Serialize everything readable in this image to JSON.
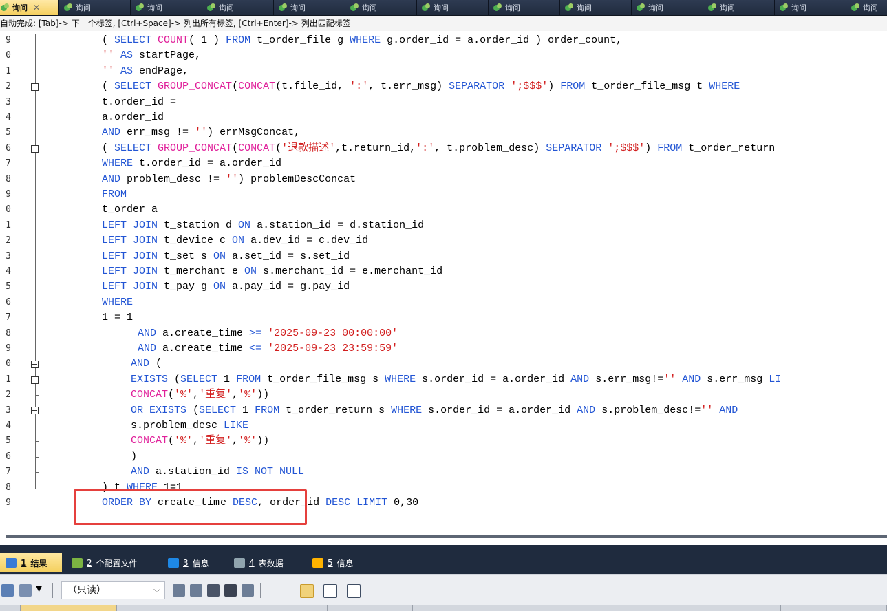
{
  "tabs": {
    "active_label": "询问",
    "close_glyph": "✕",
    "other_label": "询问",
    "other_count": 12
  },
  "hint": {
    "text": "自动完成: [Tab]-> 下一个标签, [Ctrl+Space]-> 列出所有标签, [Ctrl+Enter]-> 列出匹配标签"
  },
  "editor": {
    "line_numbers": [
      "9",
      "0",
      "1",
      "2",
      "3",
      "4",
      "5",
      "6",
      "7",
      "8",
      "9",
      "0",
      "1",
      "2",
      "3",
      "4",
      "5",
      "6",
      "7",
      "8",
      "9",
      "0",
      "1",
      "2",
      "3",
      "4",
      "5",
      "6",
      "7",
      "8",
      "9"
    ],
    "lines": [
      {
        "indent": "0",
        "tokens": [
          [
            "p",
            "( "
          ],
          [
            "kw",
            "SELECT "
          ],
          [
            "fn",
            "COUNT"
          ],
          [
            "p",
            "( 1 ) "
          ],
          [
            "kw",
            "FROM "
          ],
          [
            "p",
            "t_order_file g "
          ],
          [
            "kw",
            "WHERE "
          ],
          [
            "p",
            "g.order_id = a.order_id ) order_count,"
          ]
        ]
      },
      {
        "indent": "0",
        "tokens": [
          [
            "str",
            "'' "
          ],
          [
            "kw",
            "AS "
          ],
          [
            "p",
            "startPage,"
          ]
        ]
      },
      {
        "indent": "0",
        "tokens": [
          [
            "str",
            "'' "
          ],
          [
            "kw",
            "AS "
          ],
          [
            "p",
            "endPage,"
          ]
        ]
      },
      {
        "indent": "0",
        "tokens": [
          [
            "p",
            "( "
          ],
          [
            "kw",
            "SELECT "
          ],
          [
            "fn",
            "GROUP_CONCAT"
          ],
          [
            "p",
            "("
          ],
          [
            "fn",
            "CONCAT"
          ],
          [
            "p",
            "(t.file_id, "
          ],
          [
            "str",
            "':'"
          ],
          [
            "p",
            ", t.err_msg) "
          ],
          [
            "kw",
            "SEPARATOR "
          ],
          [
            "str",
            "';$$$'"
          ],
          [
            "p",
            ") "
          ],
          [
            "kw",
            "FROM "
          ],
          [
            "p",
            "t_order_file_msg t "
          ],
          [
            "kw",
            "WHERE"
          ]
        ]
      },
      {
        "indent": "0",
        "tokens": [
          [
            "p",
            "t.order_id ="
          ]
        ]
      },
      {
        "indent": "0",
        "tokens": [
          [
            "p",
            "a.order_id"
          ]
        ]
      },
      {
        "indent": "0",
        "tokens": [
          [
            "kw",
            "AND "
          ],
          [
            "p",
            "err_msg != "
          ],
          [
            "str",
            "''"
          ],
          [
            "p",
            ") errMsgConcat,"
          ]
        ]
      },
      {
        "indent": "0",
        "tokens": [
          [
            "p",
            "( "
          ],
          [
            "kw",
            "SELECT "
          ],
          [
            "fn",
            "GROUP_CONCAT"
          ],
          [
            "p",
            "("
          ],
          [
            "fn",
            "CONCAT"
          ],
          [
            "p",
            "("
          ],
          [
            "str",
            "'退款描述'"
          ],
          [
            "p",
            ",t.return_id,"
          ],
          [
            "str",
            "':'"
          ],
          [
            "p",
            ", t.problem_desc) "
          ],
          [
            "kw",
            "SEPARATOR "
          ],
          [
            "str",
            "';$$$'"
          ],
          [
            "p",
            ") "
          ],
          [
            "kw",
            "FROM "
          ],
          [
            "p",
            "t_order_return"
          ]
        ]
      },
      {
        "indent": "0",
        "tokens": [
          [
            "kw",
            "WHERE "
          ],
          [
            "p",
            "t.order_id = a.order_id"
          ]
        ]
      },
      {
        "indent": "0",
        "tokens": [
          [
            "kw",
            "AND "
          ],
          [
            "p",
            "problem_desc != "
          ],
          [
            "str",
            "''"
          ],
          [
            "p",
            ") problemDescConcat"
          ]
        ]
      },
      {
        "indent": "0",
        "tokens": [
          [
            "kw",
            "FROM"
          ]
        ]
      },
      {
        "indent": "0",
        "tokens": [
          [
            "p",
            "t_order a"
          ]
        ]
      },
      {
        "indent": "0",
        "tokens": [
          [
            "kw",
            "LEFT JOIN "
          ],
          [
            "p",
            "t_station d "
          ],
          [
            "kw",
            "ON "
          ],
          [
            "p",
            "a.station_id = d.station_id"
          ]
        ]
      },
      {
        "indent": "0",
        "tokens": [
          [
            "kw",
            "LEFT JOIN "
          ],
          [
            "p",
            "t_device c "
          ],
          [
            "kw",
            "ON "
          ],
          [
            "p",
            "a.dev_id = c.dev_id"
          ]
        ]
      },
      {
        "indent": "0",
        "tokens": [
          [
            "kw",
            "LEFT JOIN "
          ],
          [
            "p",
            "t_set s "
          ],
          [
            "kw",
            "ON "
          ],
          [
            "p",
            "a.set_id = s.set_id"
          ]
        ]
      },
      {
        "indent": "0",
        "tokens": [
          [
            "kw",
            "LEFT JOIN "
          ],
          [
            "p",
            "t_merchant e "
          ],
          [
            "kw",
            "ON "
          ],
          [
            "p",
            "s.merchant_id = e.merchant_id"
          ]
        ]
      },
      {
        "indent": "0",
        "tokens": [
          [
            "kw",
            "LEFT JOIN "
          ],
          [
            "p",
            "t_pay g "
          ],
          [
            "kw",
            "ON "
          ],
          [
            "p",
            "a.pay_id = g.pay_id"
          ]
        ]
      },
      {
        "indent": "0",
        "tokens": [
          [
            "kw",
            "WHERE"
          ]
        ]
      },
      {
        "indent": "0",
        "tokens": [
          [
            "p",
            "1 = 1"
          ]
        ]
      },
      {
        "indent": "2",
        "tokens": [
          [
            "kw",
            "AND "
          ],
          [
            "p",
            "a.create_time "
          ],
          [
            "kw",
            ">= "
          ],
          [
            "str",
            "'2025-09-23 00:00:00'"
          ]
        ]
      },
      {
        "indent": "2",
        "tokens": [
          [
            "kw",
            "AND "
          ],
          [
            "p",
            "a.create_time "
          ],
          [
            "kw",
            "<= "
          ],
          [
            "str",
            "'2025-09-23 23:59:59'"
          ]
        ]
      },
      {
        "indent": "1",
        "tokens": [
          [
            "kw",
            "AND "
          ],
          [
            "p",
            "("
          ]
        ]
      },
      {
        "indent": "1",
        "tokens": [
          [
            "kw",
            "EXISTS "
          ],
          [
            "p",
            "("
          ],
          [
            "kw",
            "SELECT "
          ],
          [
            "p",
            "1 "
          ],
          [
            "kw",
            "FROM "
          ],
          [
            "p",
            "t_order_file_msg s "
          ],
          [
            "kw",
            "WHERE "
          ],
          [
            "p",
            "s.order_id = a.order_id "
          ],
          [
            "kw",
            "AND "
          ],
          [
            "p",
            "s.err_msg!="
          ],
          [
            "str",
            "''"
          ],
          [
            "kw",
            " AND "
          ],
          [
            "p",
            "s.err_msg "
          ],
          [
            "kw",
            "LI"
          ]
        ]
      },
      {
        "indent": "1",
        "tokens": [
          [
            "fn",
            "CONCAT"
          ],
          [
            "p",
            "("
          ],
          [
            "str",
            "'%'"
          ],
          [
            "p",
            ","
          ],
          [
            "str",
            "'重复'"
          ],
          [
            "p",
            ","
          ],
          [
            "str",
            "'%'"
          ],
          [
            "p",
            "))"
          ]
        ]
      },
      {
        "indent": "1",
        "tokens": [
          [
            "kw",
            "OR EXISTS "
          ],
          [
            "p",
            "("
          ],
          [
            "kw",
            "SELECT "
          ],
          [
            "p",
            "1 "
          ],
          [
            "kw",
            "FROM "
          ],
          [
            "p",
            "t_order_return s "
          ],
          [
            "kw",
            "WHERE "
          ],
          [
            "p",
            "s.order_id = a.order_id "
          ],
          [
            "kw",
            "AND "
          ],
          [
            "p",
            "s.problem_desc!="
          ],
          [
            "str",
            "''"
          ],
          [
            "kw",
            " AND"
          ]
        ]
      },
      {
        "indent": "1",
        "tokens": [
          [
            "p",
            "s.problem_desc "
          ],
          [
            "kw",
            "LIKE"
          ]
        ]
      },
      {
        "indent": "1",
        "tokens": [
          [
            "fn",
            "CONCAT"
          ],
          [
            "p",
            "("
          ],
          [
            "str",
            "'%'"
          ],
          [
            "p",
            ","
          ],
          [
            "str",
            "'重复'"
          ],
          [
            "p",
            ","
          ],
          [
            "str",
            "'%'"
          ],
          [
            "p",
            "))"
          ]
        ]
      },
      {
        "indent": "1",
        "tokens": [
          [
            "p",
            ")"
          ]
        ]
      },
      {
        "indent": "1",
        "tokens": [
          [
            "kw",
            "AND "
          ],
          [
            "p",
            "a.station_id "
          ],
          [
            "kw",
            "IS NOT NULL"
          ]
        ]
      },
      {
        "indent": "0",
        "tokens": [
          [
            "p",
            ") t "
          ],
          [
            "kw",
            "WHERE "
          ],
          [
            "p",
            "1=1"
          ]
        ]
      },
      {
        "indent": "0",
        "tokens": [
          [
            "kw",
            "ORDER BY "
          ],
          [
            "p",
            "create_tim"
          ],
          [
            "cursor",
            ""
          ],
          [
            "p",
            "e "
          ],
          [
            "kw",
            "DESC"
          ],
          [
            "p",
            ", order_id "
          ],
          [
            "kw",
            "DESC LIMIT "
          ],
          [
            "p",
            "0,30"
          ]
        ]
      }
    ]
  },
  "results": {
    "tabs": [
      {
        "num": "1",
        "label": "结果",
        "icon": "grid-icon",
        "active": true
      },
      {
        "num": "2",
        "label": "个配置文件",
        "icon": "profile-icon",
        "active": false
      },
      {
        "num": "3",
        "label": "信息",
        "icon": "info-icon",
        "active": false
      },
      {
        "num": "4",
        "label": "表数据",
        "icon": "table-icon",
        "active": false
      },
      {
        "num": "5",
        "label": "信息",
        "icon": "chart-info-icon",
        "active": false
      }
    ]
  },
  "toolbar": {
    "mode_value": "（只读）",
    "mode_arrow": "⌵"
  }
}
